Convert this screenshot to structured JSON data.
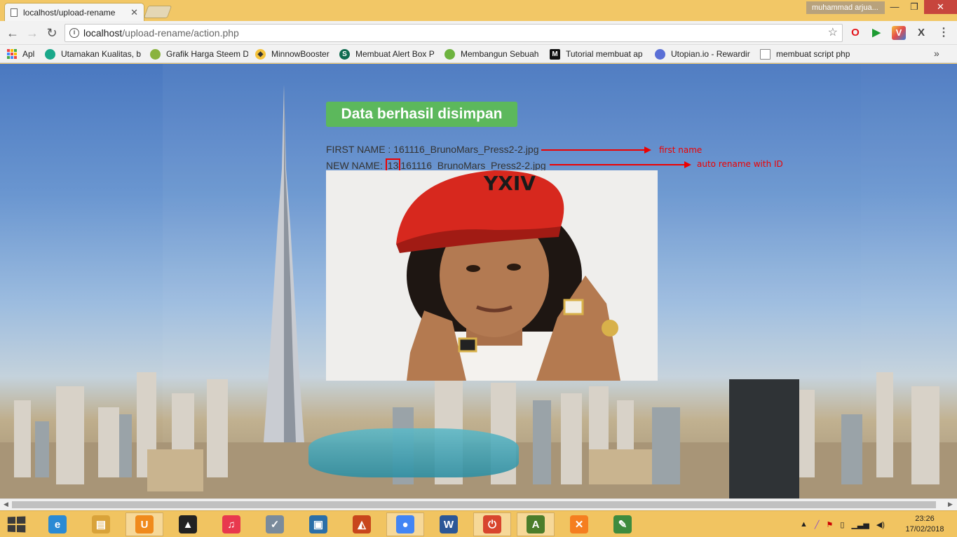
{
  "browser": {
    "tab_title": "localhost/upload-rename",
    "profile_name": "muhammad arjua...",
    "url_host": "localhost",
    "url_path": "/upload-rename/action.php"
  },
  "bookmarks": [
    {
      "label": "Apl",
      "icon": "apps-icon"
    },
    {
      "label": "Utamakan Kualitas, b",
      "icon": "green-circle-icon",
      "color": "#1aa88a"
    },
    {
      "label": "Grafik Harga Steem D",
      "icon": "android-icon",
      "color": "#8ab33e"
    },
    {
      "label": "MinnowBooster",
      "icon": "minnow-icon",
      "color": "#333333"
    },
    {
      "label": "Membuat Alert Box P",
      "icon": "steemit-icon",
      "color": "#0f6b4f"
    },
    {
      "label": "Membangun Sebuah",
      "icon": "leaf-icon",
      "color": "#6db33f"
    },
    {
      "label": "Tutorial membuat ap",
      "icon": "medium-icon",
      "color": "#111111"
    },
    {
      "label": "Utopian.io - Rewardir",
      "icon": "utopian-icon",
      "color": "#5a6fd6"
    },
    {
      "label": "membuat script php",
      "icon": "page-icon",
      "color": "#888888"
    }
  ],
  "page": {
    "banner": "Data berhasil disimpan",
    "first_label": "FIRST NAME : ",
    "first_value": "161116_BrunoMars_Press2-2.jpg",
    "new_label": "NEW NAME: ",
    "new_id": "13",
    "new_value": "161116_BrunoMars_Press2-2.jpg",
    "annotation_first": "first name",
    "annotation_new": "auto rename with ID",
    "cap_text": "YXIV"
  },
  "taskbar": {
    "apps": [
      {
        "name": "ie-icon",
        "glyph": "e",
        "color": "#2a8ad4"
      },
      {
        "name": "file-explorer-icon",
        "glyph": "▤",
        "color": "#d9a33a"
      },
      {
        "name": "uc-browser-icon",
        "glyph": "U",
        "color": "#f08a1c",
        "active": true
      },
      {
        "name": "aimp-icon",
        "glyph": "▲",
        "color": "#222222"
      },
      {
        "name": "itunes-icon",
        "glyph": "♫",
        "color": "#e8384e"
      },
      {
        "name": "installer-icon",
        "glyph": "✓",
        "color": "#7a8b9c"
      },
      {
        "name": "screen-icon",
        "glyph": "▣",
        "color": "#2b6fa8"
      },
      {
        "name": "matlab-icon",
        "glyph": "◭",
        "color": "#c8461c"
      },
      {
        "name": "chrome-icon",
        "glyph": "●",
        "color": "#4285f4",
        "active": true
      },
      {
        "name": "word-icon",
        "glyph": "W",
        "color": "#2b5797"
      },
      {
        "name": "power-icon",
        "glyph": "⏻",
        "color": "#d8452e",
        "active": true
      },
      {
        "name": "sublime-icon",
        "glyph": "A",
        "color": "#4b7d2b",
        "active": true
      },
      {
        "name": "xampp-icon",
        "glyph": "✕",
        "color": "#f57e20"
      },
      {
        "name": "notepad-icon",
        "glyph": "✎",
        "color": "#3e8b3e"
      }
    ],
    "time": "23:26",
    "date": "17/02/2018"
  }
}
